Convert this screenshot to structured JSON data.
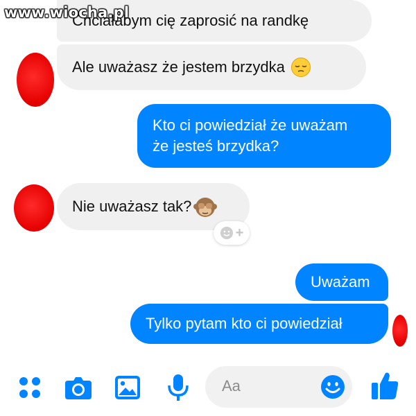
{
  "watermark": "www.wiocha.pl",
  "messages": [
    {
      "text": "Chciałabym cię zaprosić na randkę",
      "from": "them"
    },
    {
      "text": "Ale uważasz że jestem brzydka",
      "from": "them",
      "emoji": "pensive-face"
    },
    {
      "line1": "Kto ci powiedział że uważam",
      "line2": "że jesteś brzydka?",
      "from": "me"
    },
    {
      "text": "Nie uważasz tak?",
      "from": "them",
      "emoji": "see-no-evil-monkey"
    },
    {
      "text": "Uważam",
      "from": "me"
    },
    {
      "text": "Tylko pytam kto ci powiedział",
      "from": "me"
    }
  ],
  "composer": {
    "placeholder": "Aa",
    "icons": [
      "apps-icon",
      "camera-icon",
      "gallery-icon",
      "microphone-icon",
      "emoji-icon",
      "thumbs-up-icon"
    ]
  },
  "colors": {
    "outgoing": "#0084ff",
    "incoming": "#f0f0f0",
    "redaction": "#e60000"
  }
}
